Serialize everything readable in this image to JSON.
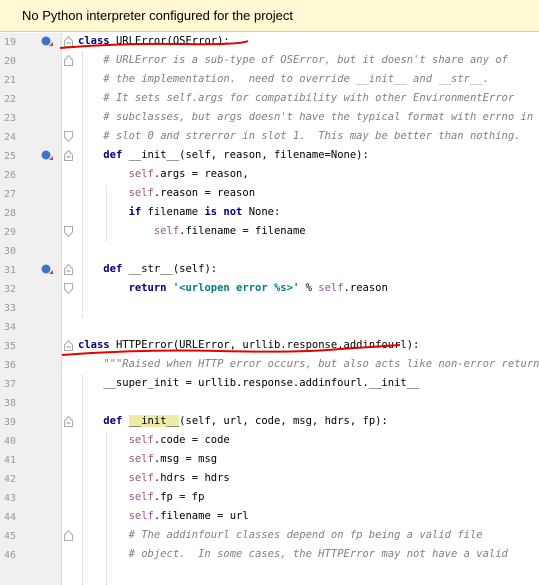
{
  "banner": {
    "text": "No Python interpreter configured for the project"
  },
  "lines": [
    {
      "n": "19",
      "marker": "override-icon",
      "fold": "open",
      "segs": [
        [
          "kw",
          "class "
        ],
        [
          "",
          "URLError(OSError):"
        ]
      ]
    },
    {
      "n": "20",
      "fold": "body",
      "segs": [
        [
          "",
          "    "
        ],
        [
          "cm",
          "# URLError is a sub-type of OSError, but it doesn't share any of"
        ]
      ]
    },
    {
      "n": "21",
      "segs": [
        [
          "",
          "    "
        ],
        [
          "cm",
          "# the implementation.  need to override __init__ and __str__."
        ]
      ]
    },
    {
      "n": "22",
      "segs": [
        [
          "",
          "    "
        ],
        [
          "cm",
          "# It sets self.args for compatibility with other EnvironmentError"
        ]
      ]
    },
    {
      "n": "23",
      "segs": [
        [
          "",
          "    "
        ],
        [
          "cm",
          "# subclasses, but args doesn't have the typical format with errno in"
        ]
      ]
    },
    {
      "n": "24",
      "fold": "end",
      "segs": [
        [
          "",
          "    "
        ],
        [
          "cm",
          "# slot 0 and strerror in slot 1.  This may be better than nothing."
        ]
      ]
    },
    {
      "n": "25",
      "marker": "override-icon",
      "fold": "open",
      "segs": [
        [
          "",
          "    "
        ],
        [
          "kw",
          "def "
        ],
        [
          "",
          "__init__(self, reason, filename=None):"
        ]
      ]
    },
    {
      "n": "26",
      "segs": [
        [
          "",
          "        "
        ],
        [
          "sf",
          "self"
        ],
        [
          "",
          ".args = reason,"
        ]
      ]
    },
    {
      "n": "27",
      "segs": [
        [
          "",
          "        "
        ],
        [
          "sf",
          "self"
        ],
        [
          "",
          ".reason = reason"
        ]
      ]
    },
    {
      "n": "28",
      "segs": [
        [
          "",
          "        "
        ],
        [
          "kw",
          "if "
        ],
        [
          "",
          "filename "
        ],
        [
          "kw",
          "is not "
        ],
        [
          "",
          "None:"
        ]
      ]
    },
    {
      "n": "29",
      "fold": "end",
      "segs": [
        [
          "",
          "            "
        ],
        [
          "sf",
          "self"
        ],
        [
          "",
          ".filename = filename"
        ]
      ]
    },
    {
      "n": "30",
      "segs": []
    },
    {
      "n": "31",
      "marker": "override-icon",
      "fold": "open",
      "segs": [
        [
          "",
          "    "
        ],
        [
          "kw",
          "def "
        ],
        [
          "",
          "__str__(self):"
        ]
      ]
    },
    {
      "n": "32",
      "fold": "end",
      "segs": [
        [
          "",
          "        "
        ],
        [
          "kw",
          "return "
        ],
        [
          "str",
          "'<urlopen error %s>'"
        ],
        [
          "",
          " % "
        ],
        [
          "sf",
          "self"
        ],
        [
          "",
          ".reason"
        ]
      ]
    },
    {
      "n": "33",
      "segs": []
    },
    {
      "n": "34",
      "segs": []
    },
    {
      "n": "35",
      "fold": "open",
      "segs": [
        [
          "kw",
          "class "
        ],
        [
          "",
          "HTTPError(URLError, urllib.response.addinfourl):"
        ]
      ]
    },
    {
      "n": "36",
      "segs": [
        [
          "",
          "    "
        ],
        [
          "doc",
          "\"\"\"Raised when HTTP error occurs, but also acts like non-error return\"\"\""
        ]
      ]
    },
    {
      "n": "37",
      "segs": [
        [
          "",
          "    __super_init = urllib.response.addinfourl.__init__"
        ]
      ]
    },
    {
      "n": "38",
      "segs": []
    },
    {
      "n": "39",
      "fold": "open",
      "segs": [
        [
          "",
          "    "
        ],
        [
          "kw",
          "def "
        ],
        [
          "hl",
          "__init__"
        ],
        [
          "",
          "(self, url, code, msg, hdrs, fp):"
        ]
      ]
    },
    {
      "n": "40",
      "segs": [
        [
          "",
          "        "
        ],
        [
          "sf",
          "self"
        ],
        [
          "",
          ".code = code"
        ]
      ]
    },
    {
      "n": "41",
      "segs": [
        [
          "",
          "        "
        ],
        [
          "sf",
          "self"
        ],
        [
          "",
          ".msg = msg"
        ]
      ]
    },
    {
      "n": "42",
      "segs": [
        [
          "",
          "        "
        ],
        [
          "sf",
          "self"
        ],
        [
          "",
          ".hdrs = hdrs"
        ]
      ]
    },
    {
      "n": "43",
      "segs": [
        [
          "",
          "        "
        ],
        [
          "sf",
          "self"
        ],
        [
          "",
          ".fp = fp"
        ]
      ]
    },
    {
      "n": "44",
      "segs": [
        [
          "",
          "        "
        ],
        [
          "sf",
          "self"
        ],
        [
          "",
          ".filename = url"
        ]
      ]
    },
    {
      "n": "45",
      "fold": "body",
      "segs": [
        [
          "",
          "        "
        ],
        [
          "cm",
          "# The addinfourl classes depend on fp being a valid file"
        ]
      ]
    },
    {
      "n": "46",
      "segs": [
        [
          "",
          "        "
        ],
        [
          "cm",
          "# object.  In some cases, the HTTPError may not have a valid"
        ]
      ]
    }
  ]
}
